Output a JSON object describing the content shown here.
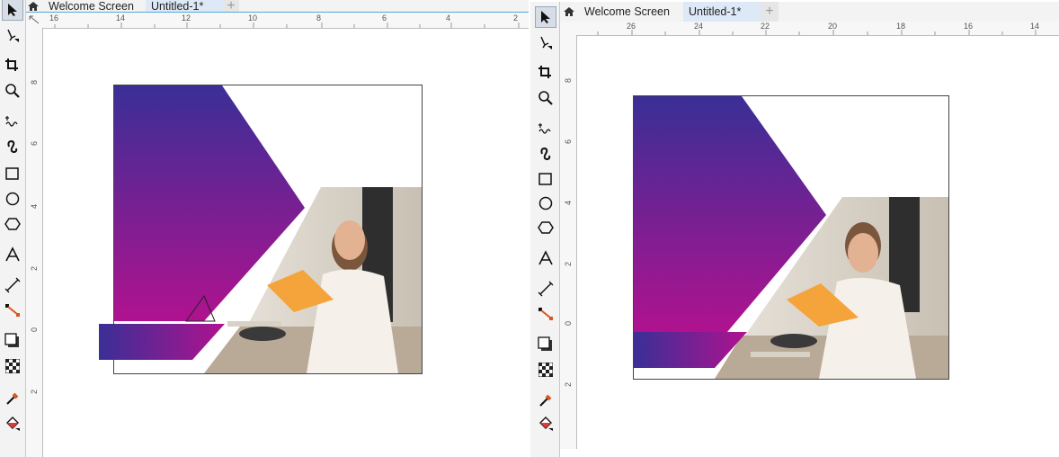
{
  "tabs": {
    "home_label": "Welcome Screen",
    "doc_label": "Untitled-1*"
  },
  "icons": {
    "home": "home-icon",
    "new_tab": "plus-icon",
    "tools": [
      "pick-tool-icon",
      "shape-tool-icon",
      "crop-tool-icon",
      "zoom-tool-icon",
      "freehand-tool-icon",
      "artistic-media-icon",
      "rectangle-tool-icon",
      "ellipse-tool-icon",
      "polygon-tool-icon",
      "text-tool-icon",
      "dimension-tool-icon",
      "connector-tool-icon",
      "drop-shadow-icon",
      "transparency-icon",
      "eyedropper-icon",
      "interactive-fill-icon"
    ]
  },
  "left_view": {
    "ruler_h": [
      "16",
      "14",
      "12",
      "10",
      "8",
      "6",
      "4",
      "2"
    ],
    "ruler_v": [
      "8",
      "6",
      "4",
      "2",
      "0",
      "2"
    ]
  },
  "right_view": {
    "ruler_h": [
      "26",
      "24",
      "22",
      "20",
      "18",
      "16",
      "14"
    ],
    "ruler_v": [
      "8",
      "6",
      "4",
      "2",
      "0",
      "2"
    ]
  },
  "colors": {
    "gradient_top": "#3a2f96",
    "gradient_bottom": "#b0128f",
    "tab_underline": "#5aa7d8",
    "toolbox_bg": "#f3f3f3"
  }
}
